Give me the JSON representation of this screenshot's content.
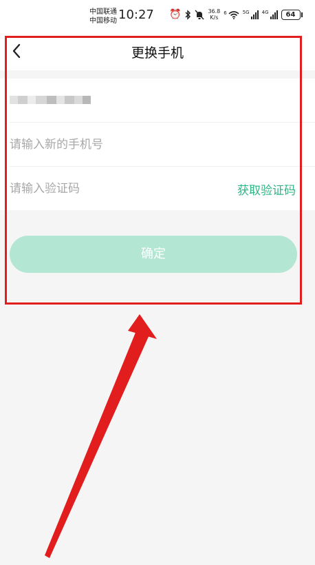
{
  "status_bar": {
    "carrier_1": "中国联通",
    "carrier_2": "中国移动",
    "time": "10:27",
    "net_speed_value": "36.8",
    "net_speed_unit": "K/s",
    "wifi_badge": "6",
    "network_5g": "5G",
    "network_4g": "4G",
    "battery": "64",
    "icons": [
      "alarm-icon",
      "bluetooth-icon",
      "mute-icon",
      "wifi-icon",
      "signal-icon",
      "signal-icon",
      "battery-icon"
    ]
  },
  "header": {
    "title": "更换手机",
    "back_icon": "chevron-left-icon"
  },
  "form": {
    "current_phone_masked": true,
    "new_phone_placeholder": "请输入新的手机号",
    "code_placeholder": "请输入验证码",
    "get_code_label": "获取验证码"
  },
  "confirm_button": {
    "label": "确定"
  },
  "colors": {
    "accent": "#30b484",
    "button_disabled": "#b4e6d4",
    "annotation": "#e11d1d",
    "background": "#f5f5f5"
  }
}
